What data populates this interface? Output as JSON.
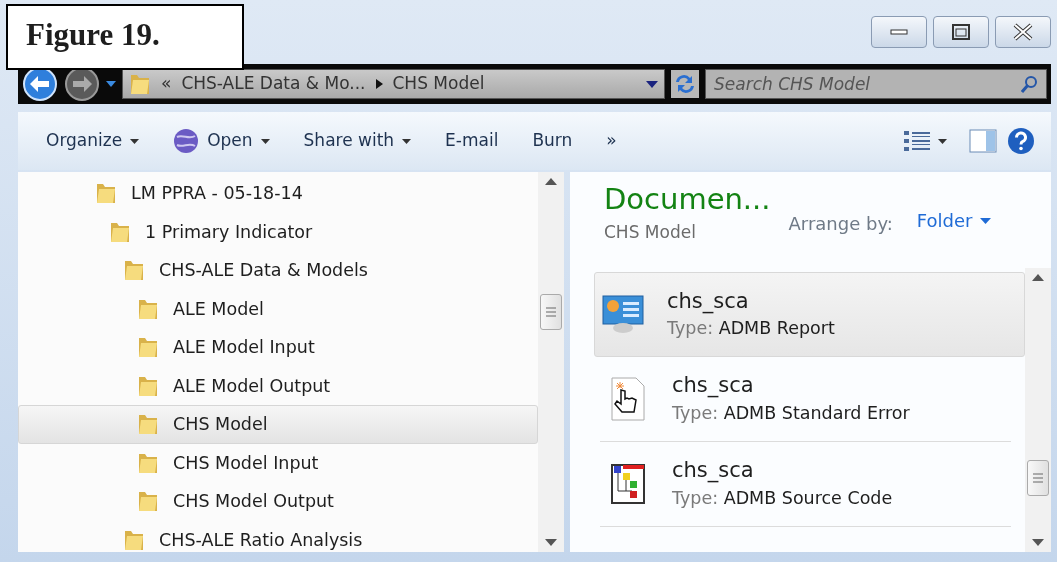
{
  "figure_label": "Figure 19.",
  "address_bar": {
    "overflow": "«",
    "crumbs": [
      "CHS-ALE Data & Mo...",
      "CHS Model"
    ]
  },
  "search": {
    "placeholder": "Search CHS Model"
  },
  "toolbar": [
    {
      "label": "Organize",
      "kind": "menu"
    },
    {
      "label": "Open",
      "kind": "open"
    },
    {
      "label": "Share with",
      "kind": "menu"
    },
    {
      "label": "E-mail",
      "kind": "plain"
    },
    {
      "label": "Burn",
      "kind": "plain"
    },
    {
      "label": "»",
      "kind": "plain"
    }
  ],
  "tree": [
    {
      "label": "LM PPRA - 05-18-14",
      "selected": false,
      "children": [
        {
          "label": "1 Primary Indicator",
          "selected": false,
          "children": [
            {
              "label": "CHS-ALE Data & Models",
              "selected": false,
              "children": [
                {
                  "label": "ALE Model",
                  "selected": false
                },
                {
                  "label": "ALE Model Input",
                  "selected": false
                },
                {
                  "label": "ALE Model Output",
                  "selected": false
                },
                {
                  "label": "CHS Model",
                  "selected": true
                },
                {
                  "label": "CHS Model Input",
                  "selected": false
                },
                {
                  "label": "CHS Model Output",
                  "selected": false
                }
              ]
            },
            {
              "label": "CHS-ALE Ratio Analysis",
              "selected": false
            }
          ]
        }
      ]
    }
  ],
  "content_header": {
    "title": "Documen...",
    "subtitle": "CHS Model",
    "arrange_label": "Arrange by:",
    "arrange_value": "Folder"
  },
  "files": [
    {
      "name": "chs_sca",
      "type_label": "Type:",
      "type": "ADMB Report",
      "kind": "report",
      "selected": true
    },
    {
      "name": "chs_sca",
      "type_label": "Type:",
      "type": "ADMB Standard Error",
      "kind": "error",
      "selected": false
    },
    {
      "name": "chs_sca",
      "type_label": "Type:",
      "type": "ADMB Source Code",
      "kind": "source",
      "selected": false
    }
  ]
}
